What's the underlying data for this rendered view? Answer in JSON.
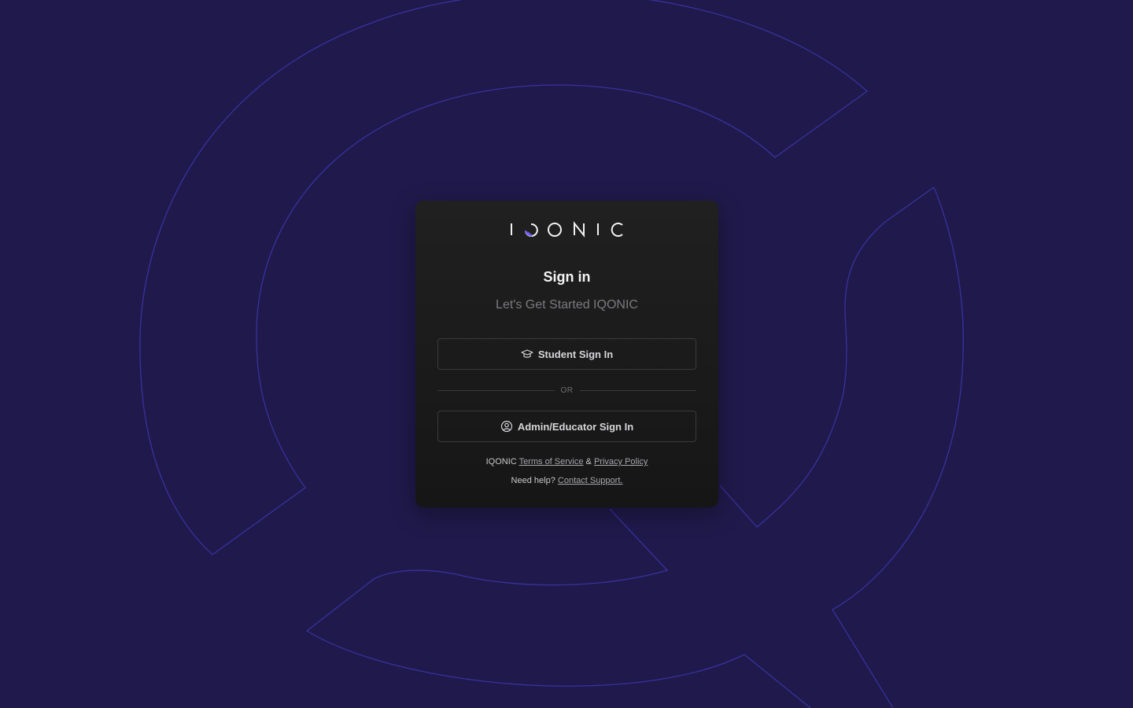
{
  "brand": {
    "logo_text": "IQONIC",
    "accent_color": "#6f5cf0"
  },
  "signin": {
    "title": "Sign in",
    "subtitle": "Let's Get Started IQONIC"
  },
  "buttons": {
    "student_label": "Student Sign In",
    "student_icon": "graduation-cap-icon",
    "admin_label": "Admin/Educator Sign In",
    "admin_icon": "user-circle-icon"
  },
  "divider": {
    "label": "OR"
  },
  "footer": {
    "brand": "IQONIC",
    "terms": "Terms of Service",
    "amp": "&",
    "privacy": "Privacy Policy",
    "help_prefix": "Need help?",
    "support": "Contact Support."
  },
  "colors": {
    "background": "#1f1a4b",
    "card": "#1b1b1b",
    "watermark_stroke": "#3a33a6"
  }
}
